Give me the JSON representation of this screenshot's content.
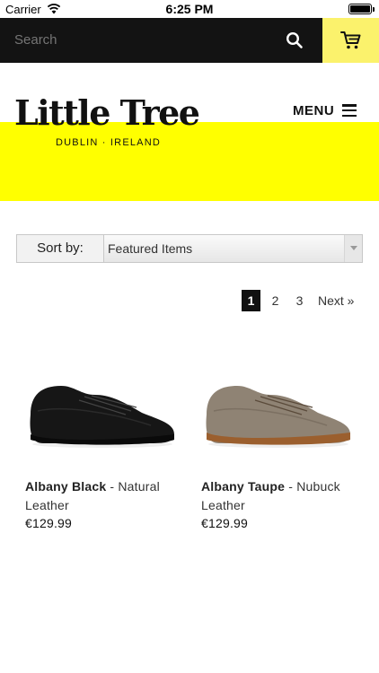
{
  "status_bar": {
    "carrier": "Carrier",
    "time": "6:25 PM"
  },
  "search": {
    "placeholder": "Search",
    "icon": "search-icon"
  },
  "cart": {
    "icon": "cart-icon",
    "color": "#fbf26c"
  },
  "header": {
    "logo": "Little Tree",
    "tagline": "DUBLIN · IRELAND",
    "menu_label": "MENU",
    "band_color": "#ffff00"
  },
  "sort": {
    "label": "Sort by:",
    "selected": "Featured Items"
  },
  "pagination": {
    "pages": [
      "1",
      "2",
      "3"
    ],
    "current": "1",
    "next": "Next »"
  },
  "products": [
    {
      "name": "Albany Black",
      "desc": " - Natural Leather",
      "price": "€129.99",
      "color": "#161616"
    },
    {
      "name": "Albany Taupe",
      "desc": " - Nubuck Leather",
      "price": "€129.99",
      "color": "#8f8374"
    }
  ]
}
